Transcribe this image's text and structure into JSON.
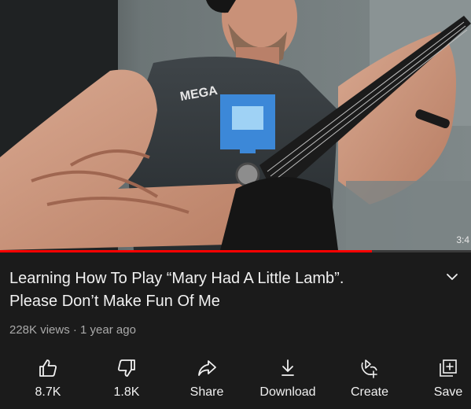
{
  "video": {
    "timestamp": "3:4",
    "progress": 0.79,
    "shirt_text": "MEGA"
  },
  "colors": {
    "background": "#1b1b1b",
    "progress": "#ff0000",
    "meta_text": "#aaaaaa"
  },
  "title": {
    "line1": "Learning How To Play “Mary Had A Little Lamb”.",
    "line2": "Please Don’t Make Fun Of Me"
  },
  "meta": {
    "text": "228K views · 1 year ago"
  },
  "actions": {
    "like": {
      "label": "8.7K",
      "icon": "thumbs-up-icon"
    },
    "dislike": {
      "label": "1.8K",
      "icon": "thumbs-down-icon"
    },
    "share": {
      "label": "Share",
      "icon": "share-icon"
    },
    "download": {
      "label": "Download",
      "icon": "download-icon"
    },
    "create": {
      "label": "Create",
      "icon": "create-icon"
    },
    "save": {
      "label": "Save",
      "icon": "save-playlist-icon"
    }
  }
}
